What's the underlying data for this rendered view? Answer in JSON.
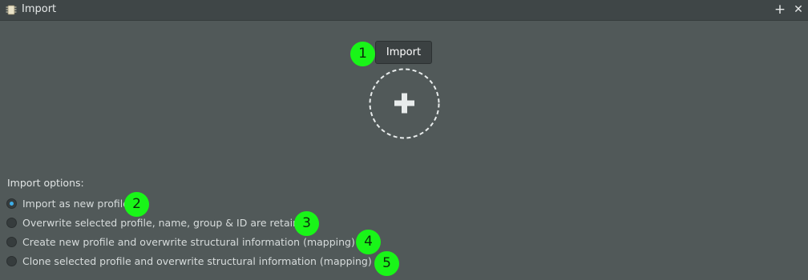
{
  "window": {
    "title": "Import",
    "app_icon": "chip-icon",
    "add_icon": "+",
    "close_icon": "✕"
  },
  "import_button": {
    "label": "Import"
  },
  "drop_zone": {
    "icon": "plus-icon",
    "glyph": "+"
  },
  "options": {
    "heading": "Import options:",
    "items": [
      {
        "label": "Import as new profile",
        "checked": true
      },
      {
        "label": "Overwrite selected profile, name, group & ID are retained",
        "checked": false
      },
      {
        "label": "Create new profile and overwrite structural information (mapping) only",
        "checked": false
      },
      {
        "label": "Clone selected profile and overwrite structural information (mapping) only",
        "checked": false
      }
    ]
  },
  "callouts": [
    "1",
    "2",
    "3",
    "4",
    "5"
  ],
  "colors": {
    "background": "#515959",
    "titlebar": "#3f4647",
    "callout": "#19f518",
    "radio_accent": "#3daee9"
  }
}
